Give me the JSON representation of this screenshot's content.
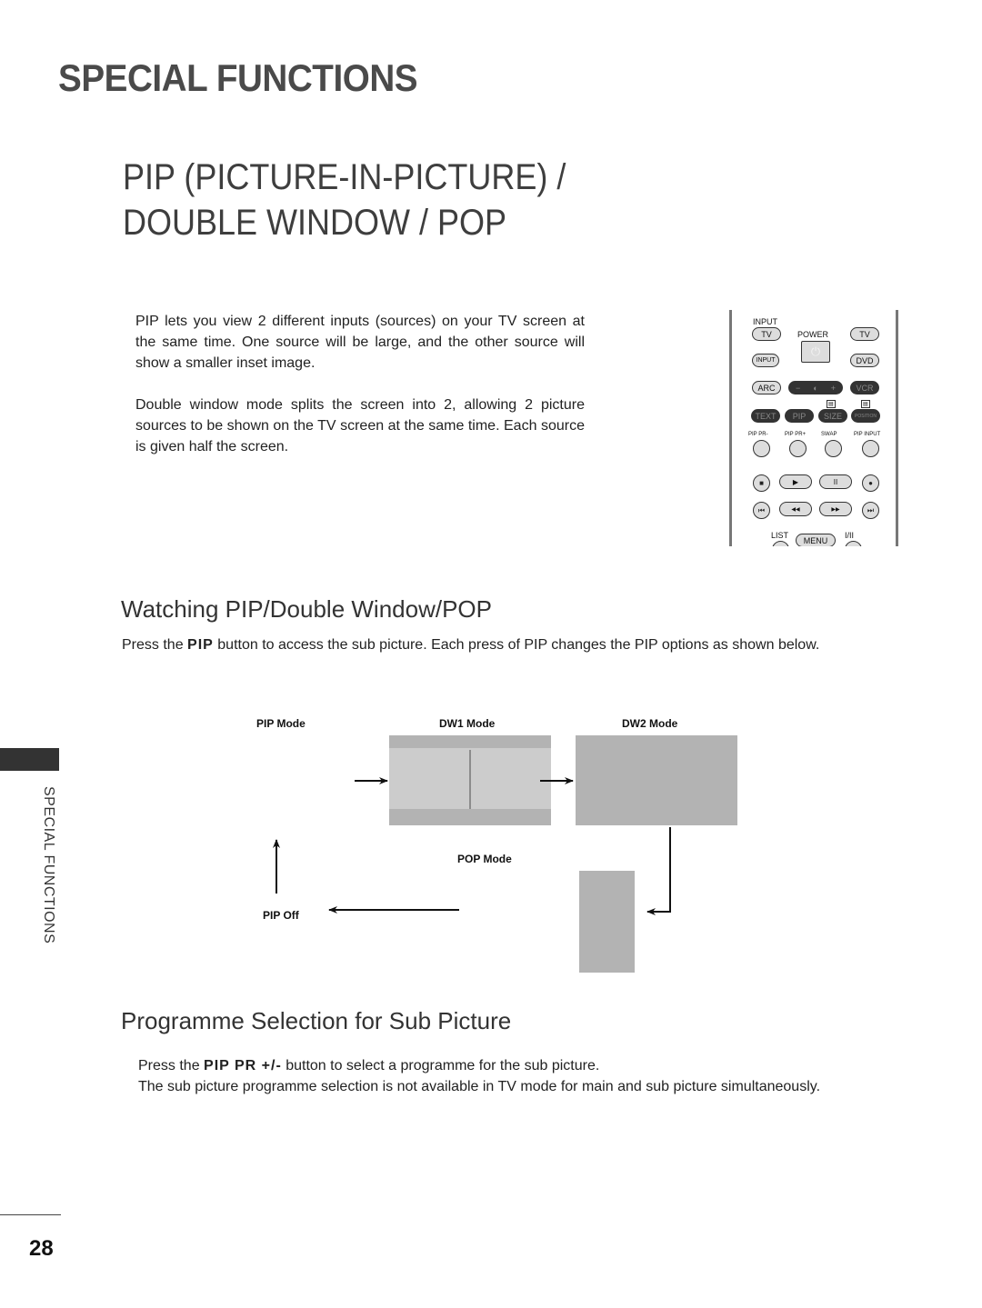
{
  "header": {
    "section_title": "SPECIAL FUNCTIONS",
    "page_title_line1": "PIP (PICTURE-IN-PICTURE) /",
    "page_title_line2": "DOUBLE WINDOW / POP"
  },
  "intro": {
    "paragraph1": "PIP lets you view 2 different inputs (sources) on your TV screen at the same time. One source will be large, and the other source will show a smaller inset image.",
    "paragraph2": "Double window mode splits the screen into 2, allowing 2 picture sources to be shown on the TV screen at the same time. Each source is given half the screen."
  },
  "remote": {
    "input_label": "INPUT",
    "tv_left": "TV",
    "power_label": "POWER",
    "power_icon": "power-icon",
    "tv_right": "TV",
    "input_btn": "INPUT",
    "dvd": "DVD",
    "arc": "ARC",
    "vol_minus": "−",
    "vol_plus": "+",
    "vcr": "VCR",
    "text": "TEXT",
    "pip": "PIP",
    "size": "SIZE",
    "position": "POSITION",
    "pip_pr_minus": "PIP PR-",
    "pip_pr_plus": "PIP PR+",
    "swap": "SWAP",
    "pip_input": "PIP INPUT",
    "stop": "■",
    "play": "▶",
    "pause": "II",
    "record": "●",
    "skip_back": "⏮",
    "rewind": "◀◀",
    "fast_forward": "▶▶",
    "skip_forward": "⏭",
    "list": "LIST",
    "menu": "MENU",
    "i_ii": "I/II"
  },
  "watching": {
    "heading": "Watching PIP/Double Window/POP",
    "text_before": "Press the ",
    "button_name": "PIP",
    "text_after": " button to access the sub picture. Each press of PIP changes the PIP options as shown below."
  },
  "diagram": {
    "pip_mode": "PIP Mode",
    "dw1_mode": "DW1 Mode",
    "dw2_mode": "DW2 Mode",
    "pop_mode": "POP Mode",
    "pip_off": "PIP Off",
    "colors": {
      "screen_dark": "#b3b3b3",
      "screen_light": "#cccccc",
      "arrow": "#111111"
    }
  },
  "programme": {
    "heading": "Programme Selection for Sub Picture",
    "line1_before": "Press the ",
    "line1_button": "PIP PR +/-",
    "line1_after": " button to select a programme for the sub picture.",
    "line2": "The sub picture programme selection is not available in TV mode for main and sub picture simultaneously."
  },
  "sidebar": {
    "tab_label": "SPECIAL FUNCTIONS"
  },
  "footer": {
    "page_number": "28"
  }
}
